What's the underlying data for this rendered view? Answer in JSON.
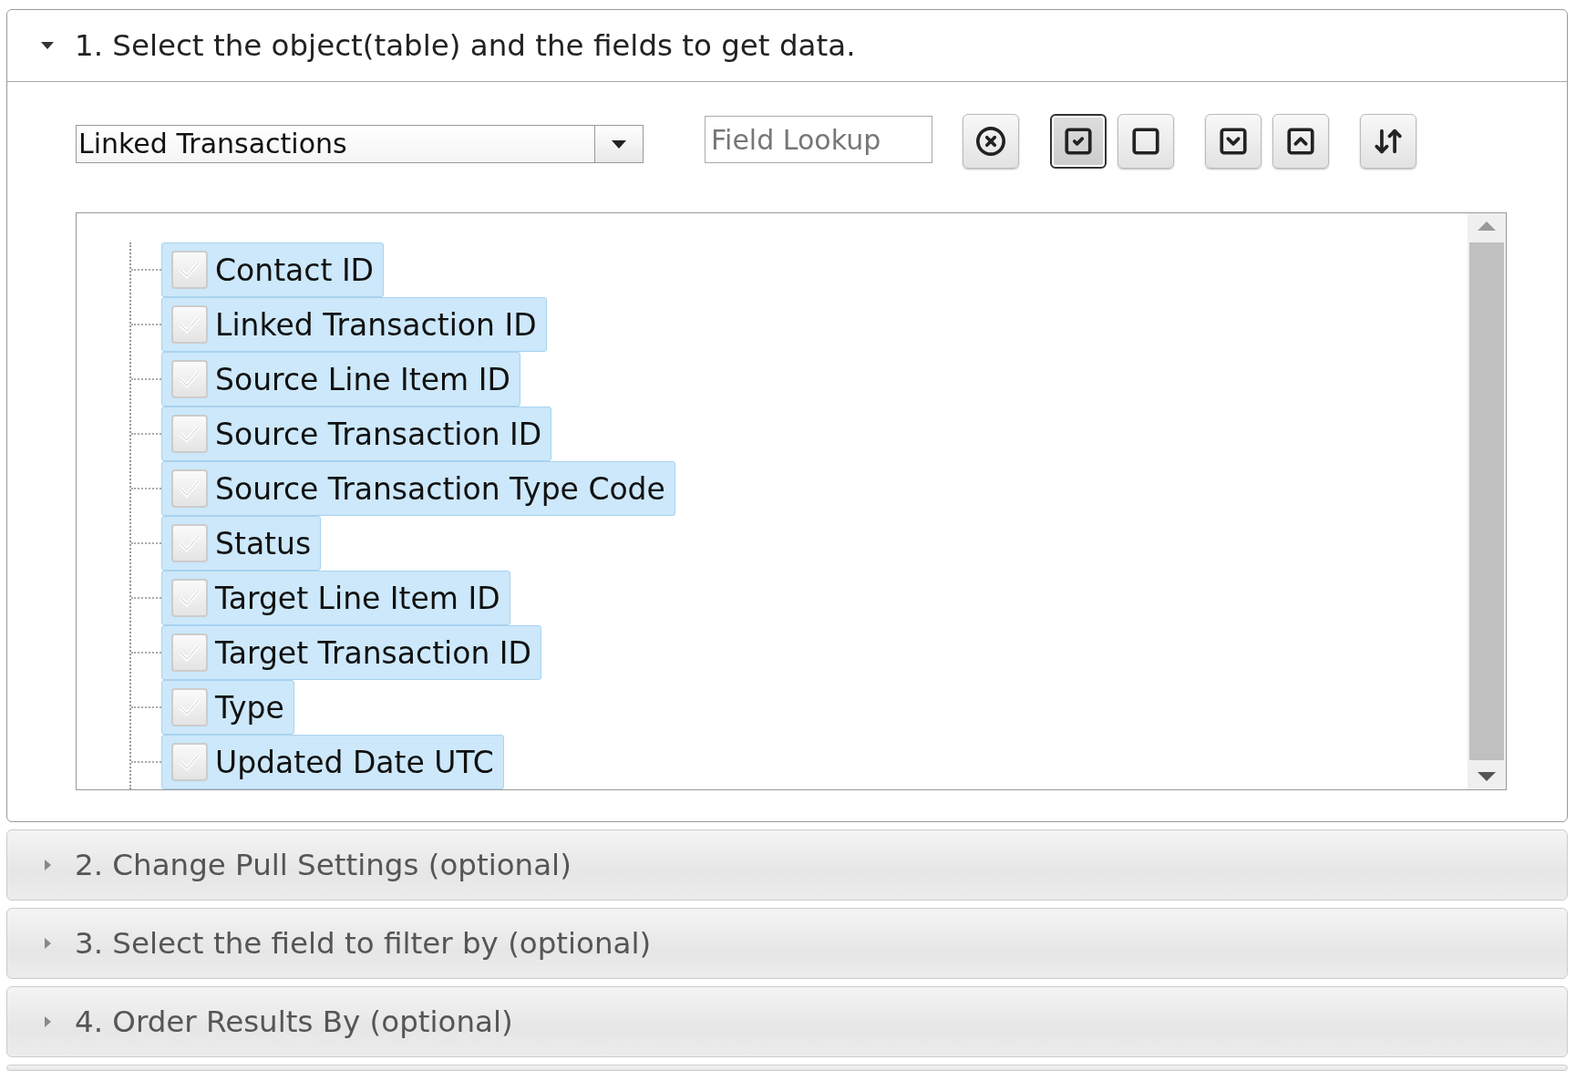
{
  "sections": [
    {
      "title": "1. Select the object(table) and the fields to get data.",
      "expanded": true,
      "object_select": {
        "value": "Linked Transactions"
      },
      "field_lookup": {
        "placeholder": "Field Lookup"
      },
      "toolbar": [
        {
          "kind": "clear",
          "pressed": false
        },
        {
          "kind": "check_all",
          "pressed": true
        },
        {
          "kind": "uncheck_all",
          "pressed": false
        },
        {
          "kind": "expand",
          "pressed": false
        },
        {
          "kind": "collapse",
          "pressed": false
        },
        {
          "kind": "sort",
          "pressed": false
        }
      ],
      "fields": [
        {
          "label": "Contact ID",
          "checked": true,
          "selected": true
        },
        {
          "label": "Linked Transaction ID",
          "checked": true,
          "selected": true
        },
        {
          "label": "Source Line Item ID",
          "checked": true,
          "selected": true
        },
        {
          "label": "Source Transaction ID",
          "checked": true,
          "selected": true
        },
        {
          "label": "Source Transaction Type Code",
          "checked": true,
          "selected": true
        },
        {
          "label": "Status",
          "checked": true,
          "selected": true
        },
        {
          "label": "Target Line Item ID",
          "checked": true,
          "selected": true
        },
        {
          "label": "Target Transaction ID",
          "checked": true,
          "selected": true
        },
        {
          "label": "Type",
          "checked": true,
          "selected": true
        },
        {
          "label": "Updated Date UTC",
          "checked": true,
          "selected": true
        }
      ]
    },
    {
      "title": "2. Change Pull Settings (optional)",
      "expanded": false
    },
    {
      "title": "3. Select the field to filter by (optional)",
      "expanded": false
    },
    {
      "title": "4. Order Results By (optional)",
      "expanded": false
    }
  ]
}
